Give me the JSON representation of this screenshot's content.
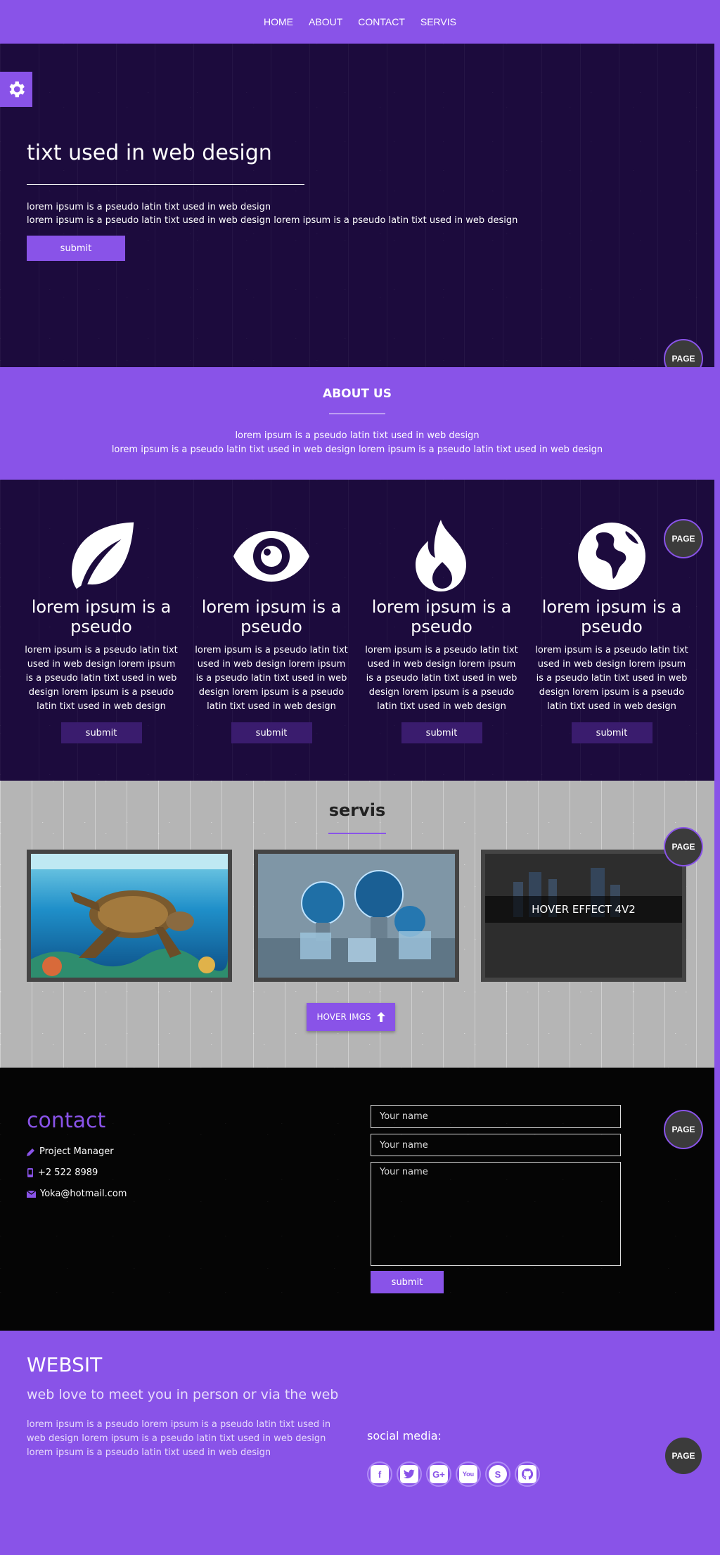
{
  "nav": {
    "items": [
      "HOME",
      "ABOUT",
      "CONTACT",
      "SERVIS"
    ]
  },
  "hero": {
    "title": "tixt used in web design",
    "line1": "lorem ipsum is a pseudo latin tixt used in web design",
    "line2": "lorem ipsum is a pseudo latin tixt used in web design lorem ipsum is a pseudo latin tixt used in web design",
    "button": "submit",
    "page_button": "PAGE"
  },
  "about": {
    "title": "ABOUT US",
    "line1": "lorem ipsum is a pseudo latin tixt used in web design",
    "line2": "lorem ipsum is a pseudo latin tixt used in web design lorem ipsum is a pseudo latin tixt used in web design"
  },
  "features": {
    "page_button": "PAGE",
    "items": [
      {
        "icon": "leaf-icon",
        "title": "lorem ipsum is a pseudo",
        "text": "lorem ipsum is a pseudo latin tixt used in web design lorem ipsum is a pseudo latin tixt used in web design lorem ipsum is a pseudo latin tixt used in web design",
        "button": "submit"
      },
      {
        "icon": "eye-icon",
        "title": "lorem ipsum is a pseudo",
        "text": "lorem ipsum is a pseudo latin tixt used in web design lorem ipsum is a pseudo latin tixt used in web design lorem ipsum is a pseudo latin tixt used in web design",
        "button": "submit"
      },
      {
        "icon": "fire-icon",
        "title": "lorem ipsum is a pseudo",
        "text": "lorem ipsum is a pseudo latin tixt used in web design lorem ipsum is a pseudo latin tixt used in web design lorem ipsum is a pseudo latin tixt used in web design",
        "button": "submit"
      },
      {
        "icon": "globe-icon",
        "title": "lorem ipsum is a pseudo",
        "text": "lorem ipsum is a pseudo latin tixt used in web design lorem ipsum is a pseudo latin tixt used in web design lorem ipsum is a pseudo latin tixt used in web design",
        "button": "submit"
      }
    ]
  },
  "servis": {
    "title": "servis",
    "page_button": "PAGE",
    "hover_label": "HOVER EFFECT 4V2",
    "button": "HOVER IMGS"
  },
  "contact": {
    "title": "contact",
    "role": "Project Manager",
    "phone": "+2 522 8989",
    "email": "Yoka@hotmail.com",
    "field1_placeholder": "Your name",
    "field2_placeholder": "Your name",
    "field3_placeholder": "Your name",
    "button": "submit",
    "page_button": "PAGE"
  },
  "footer": {
    "title": "WEBSIT",
    "tagline": "web love to meet you in person or via the web",
    "description": "lorem ipsum is a pseudo lorem ipsum is a pseudo latin tixt used in web design lorem ipsum is a pseudo latin tixt used in web design lorem ipsum is a pseudo latin tixt used in web design",
    "social_label": "social media:",
    "page_button": "PAGE",
    "socials": [
      "facebook-icon",
      "twitter-icon",
      "google-plus-icon",
      "youtube-icon",
      "skype-icon",
      "github-icon"
    ]
  },
  "colors": {
    "accent": "#8953e8",
    "dark": "#1c0b3d"
  }
}
